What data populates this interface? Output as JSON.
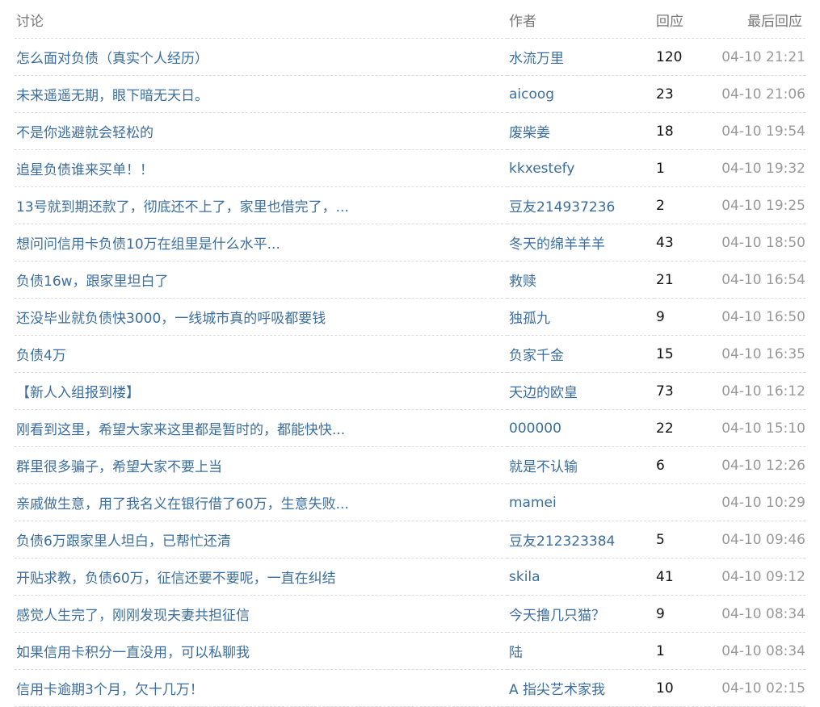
{
  "headers": {
    "title": "讨论",
    "author": "作者",
    "replies": "回应",
    "last_reply": "最后回应"
  },
  "topics": [
    {
      "title": "怎么面对负债（真实个人经历）",
      "author": "水流万里",
      "replies": "120",
      "time": "04-10 21:21"
    },
    {
      "title": "未来遥遥无期，眼下暗无天日。",
      "author": "aicoog",
      "replies": "23",
      "time": "04-10 21:06"
    },
    {
      "title": "不是你逃避就会轻松的",
      "author": "废柴姜",
      "replies": "18",
      "time": "04-10 19:54"
    },
    {
      "title": "追星负债谁来买单！！",
      "author": "kkxestefy",
      "replies": "1",
      "time": "04-10 19:32"
    },
    {
      "title": "13号就到期还款了，彻底还不上了，家里也借完了，...",
      "author": "豆友214937236",
      "replies": "2",
      "time": "04-10 19:25"
    },
    {
      "title": "想问问信用卡负债10万在组里是什么水平...",
      "author": "冬天的绵羊羊羊",
      "replies": "43",
      "time": "04-10 18:50"
    },
    {
      "title": "负债16w，跟家里坦白了",
      "author": "救赎",
      "replies": "21",
      "time": "04-10 16:54"
    },
    {
      "title": "还没毕业就负债快3000，一线城市真的呼吸都要钱",
      "author": "独孤九",
      "replies": "9",
      "time": "04-10 16:50"
    },
    {
      "title": "负债4万",
      "author": "负家千金",
      "replies": "15",
      "time": "04-10 16:35"
    },
    {
      "title": "【新人入组报到楼】",
      "author": "天边的欧皇",
      "replies": "73",
      "time": "04-10 16:12"
    },
    {
      "title": "刚看到这里，希望大家来这里都是暂时的，都能快快...",
      "author": "000000",
      "replies": "22",
      "time": "04-10 15:10"
    },
    {
      "title": "群里很多骗子，希望大家不要上当",
      "author": "就是不认输",
      "replies": "6",
      "time": "04-10 12:26"
    },
    {
      "title": "亲戚做生意，用了我名义在银行借了60万，生意失败...",
      "author": "mamei",
      "replies": "",
      "time": "04-10 10:29"
    },
    {
      "title": "负债6万跟家里人坦白，已帮忙还清",
      "author": "豆友212323384",
      "replies": "5",
      "time": "04-10 09:46"
    },
    {
      "title": "开贴求教，负债60万，征信还要不要呢，一直在纠结",
      "author": "skila",
      "replies": "41",
      "time": "04-10 09:12"
    },
    {
      "title": "感觉人生完了，刚刚发现夫妻共担征信",
      "author": "今天撸几只猫？",
      "replies": "9",
      "time": "04-10 08:34"
    },
    {
      "title": "如果信用卡积分一直没用，可以私聊我",
      "author": "陆",
      "replies": "1",
      "time": "04-10 08:34"
    },
    {
      "title": "信用卡逾期3个月，欠十几万！",
      "author": "A 指尖艺术家我",
      "replies": "10",
      "time": "04-10 02:15"
    }
  ]
}
